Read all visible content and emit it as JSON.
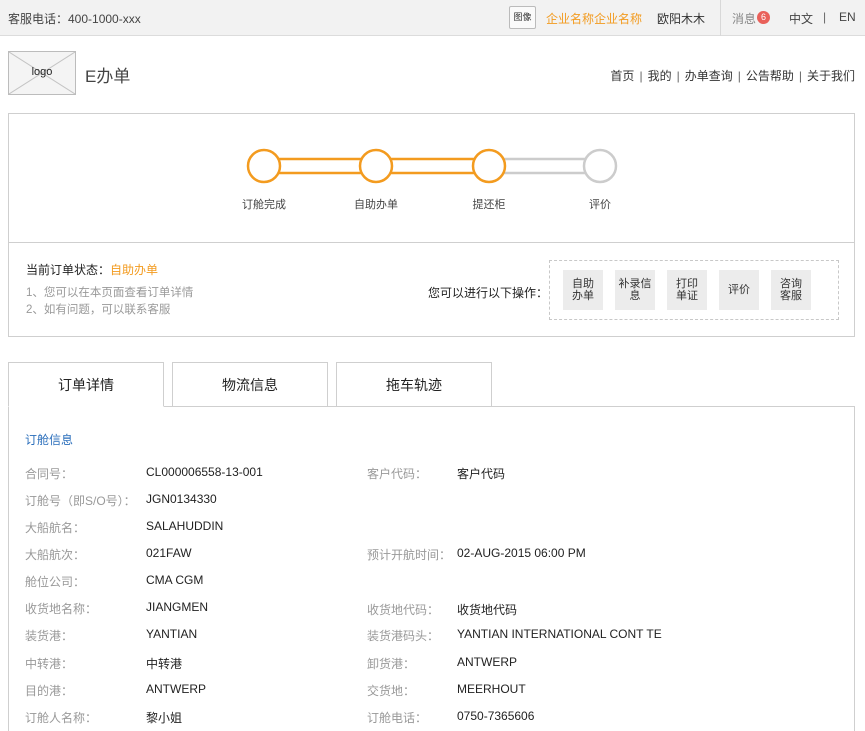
{
  "topbar": {
    "phone": "客服电话：400-1000-xxx",
    "avatar_label": "图像",
    "company": "企业名称企业名称",
    "user": "欧阳木木",
    "message_label": "消息",
    "message_count": "6",
    "lang_zh": "中文",
    "lang_sep": "|",
    "lang_en": "EN"
  },
  "header": {
    "logo": "logo",
    "title": "E办单",
    "nav": [
      "首页",
      "我的",
      "办单查询",
      "公告帮助",
      "关于我们"
    ],
    "nav_sep": "|"
  },
  "progress": {
    "steps": [
      {
        "label": "订舱完成",
        "done": true
      },
      {
        "label": "自助办单",
        "done": true
      },
      {
        "label": "提还柜",
        "done": true
      },
      {
        "label": "评价",
        "done": false
      }
    ],
    "colors": {
      "done": "#f39b1f",
      "todo": "#cccccc"
    }
  },
  "status": {
    "label": "当前订单状态：",
    "value": "自助办单",
    "hints": [
      "1、您可以在本页面查看订单详情",
      "2、如有问题，可以联系客服"
    ],
    "ops_label": "您可以进行以下操作：",
    "ops": [
      "自助\n办单",
      "补录信\n息",
      "打印\n单证",
      "评价",
      "咨询\n客服"
    ]
  },
  "tabs": [
    "订单详情",
    "物流信息",
    "拖车轨迹"
  ],
  "details": {
    "section_title": "订舱信息",
    "left": [
      {
        "label": "合同号：",
        "value": "CL000006558-13-001"
      },
      {
        "label": "订舱号（即S/O号）：",
        "value": "JGN0134330"
      },
      {
        "label": "大船航名：",
        "value": "SALAHUDDIN"
      },
      {
        "label": "大船航次：",
        "value": "021FAW"
      },
      {
        "label": "舱位公司：",
        "value": "CMA CGM"
      },
      {
        "label": "收货地名称：",
        "value": "JIANGMEN"
      },
      {
        "label": "装货港：",
        "value": "YANTIAN"
      },
      {
        "label": "中转港：",
        "value": "中转港"
      },
      {
        "label": "目的港：",
        "value": "ANTWERP"
      },
      {
        "label": "订舱人名称：",
        "value": "黎小姐"
      }
    ],
    "right": [
      {
        "label": "客户代码：",
        "value": "客户代码"
      },
      null,
      null,
      {
        "label": "预计开航时间：",
        "value": "02-AUG-2015 06:00 PM"
      },
      null,
      {
        "label": "收货地代码：",
        "value": "收货地代码"
      },
      {
        "label": "装货港码头：",
        "value": "YANTIAN INTERNATIONAL CONT TE"
      },
      {
        "label": "卸货港：",
        "value": "ANTWERP"
      },
      {
        "label": "交货地：",
        "value": "MEERHOUT"
      },
      {
        "label": "订舱电话：",
        "value": "0750-7365606"
      }
    ]
  }
}
